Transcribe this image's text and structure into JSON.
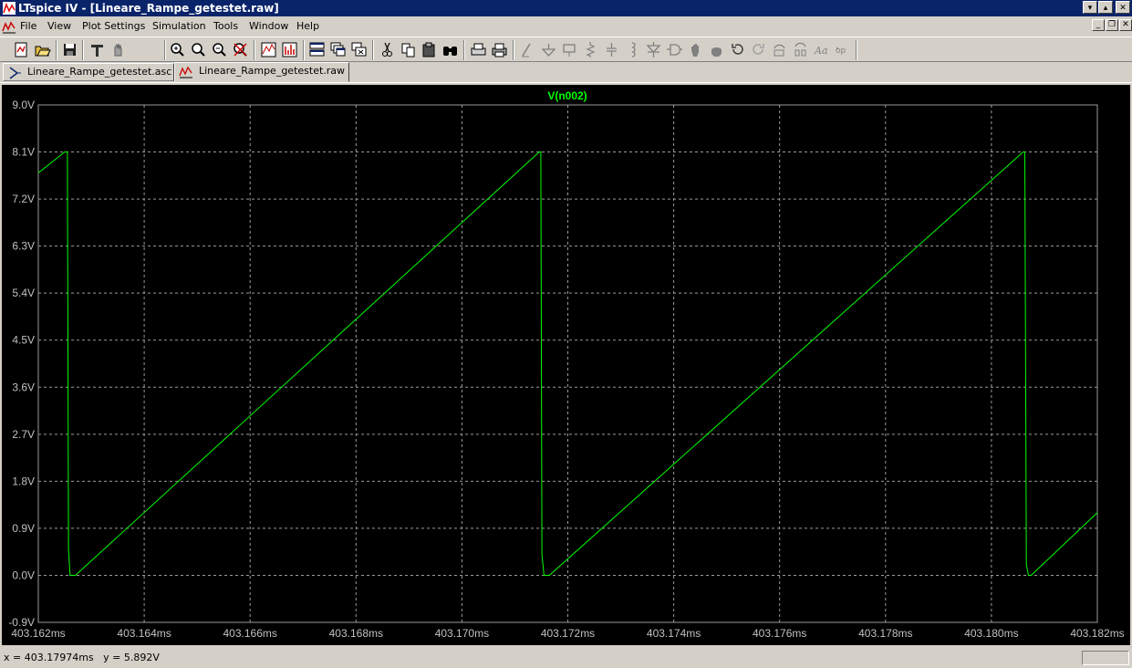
{
  "window": {
    "title": "LTspice IV - [Lineare_Rampe_getestet.raw]",
    "controls": [
      "▾",
      "▴",
      "✕"
    ],
    "mdi_controls": [
      "_",
      "❐",
      "✕"
    ]
  },
  "menu": [
    "File",
    "View",
    "Plot Settings",
    "Simulation",
    "Tools",
    "Window",
    "Help"
  ],
  "toolbar_icons": [
    "new-schematic-icon",
    "open-icon",
    "save-icon",
    "control-panel-icon",
    "run-icon",
    "halt-icon",
    "zoom-in-icon",
    "zoom-area-icon",
    "zoom-out-icon",
    "zoom-cancel-icon",
    "autorange-icon",
    "fft-icon",
    "tile-horizontal-icon",
    "cascade-icon",
    "close-all-icon",
    "cut-icon",
    "copy-icon",
    "paste-icon",
    "find-icon",
    "print-preview-icon",
    "print-icon",
    "wire-icon",
    "ground-icon",
    "label-icon",
    "resistor-icon",
    "capacitor-icon",
    "inductor-icon",
    "diode-icon",
    "component-icon",
    "move-icon",
    "drag-icon",
    "undo-icon",
    "redo-icon",
    "rotate-icon",
    "mirror-icon",
    "text-icon",
    "spice-directive-icon"
  ],
  "tabs": [
    {
      "label": "Lineare_Rampe_getestet.asc",
      "icon": "schematic-icon",
      "active": false
    },
    {
      "label": "Lineare_Rampe_getestet.raw",
      "icon": "waveform-icon",
      "active": true
    }
  ],
  "status": {
    "readout": "x = 403.17974ms   y = 5.892V"
  },
  "colors": {
    "trace": "#00ff00",
    "background": "#000000",
    "axis_text": "#c0c0c0",
    "grid": "#9a9a9a",
    "title_bar": "#0a246a",
    "window_bg": "#d4d0c8"
  },
  "chart_data": {
    "type": "line",
    "title": "",
    "xlabel": "",
    "ylabel": "",
    "grid": true,
    "legend": "top-center",
    "xlim": [
      403.162,
      403.182
    ],
    "ylim": [
      -0.9,
      9.0
    ],
    "x_unit": "ms",
    "y_unit": "V",
    "x_ticks": [
      "403.162ms",
      "403.164ms",
      "403.166ms",
      "403.168ms",
      "403.170ms",
      "403.172ms",
      "403.174ms",
      "403.176ms",
      "403.178ms",
      "403.180ms",
      "403.182ms"
    ],
    "y_ticks": [
      "9.0V",
      "8.1V",
      "7.2V",
      "6.3V",
      "5.4V",
      "4.5V",
      "3.6V",
      "2.7V",
      "1.8V",
      "0.9V",
      "0.0V",
      "-0.9V"
    ],
    "x_tick_values": [
      403.162,
      403.164,
      403.166,
      403.168,
      403.17,
      403.172,
      403.174,
      403.176,
      403.178,
      403.18,
      403.182
    ],
    "y_tick_values": [
      9.0,
      8.1,
      7.2,
      6.3,
      5.4,
      4.5,
      3.6,
      2.7,
      1.8,
      0.9,
      0.0,
      -0.9
    ],
    "series": [
      {
        "name": "V(n002)",
        "x": [
          403.162,
          403.1625,
          403.16255,
          403.16257,
          403.1626,
          403.1627,
          403.17146,
          403.17149,
          403.17151,
          403.17155,
          403.17165,
          403.1806,
          403.18063,
          403.18066,
          403.1807,
          403.18075,
          403.182
        ],
        "y": [
          7.7,
          8.1,
          8.1,
          0.5,
          0.0,
          0.0,
          8.1,
          8.1,
          0.4,
          0.0,
          0.0,
          8.1,
          8.1,
          0.2,
          0.0,
          0.0,
          1.2
        ]
      }
    ]
  }
}
